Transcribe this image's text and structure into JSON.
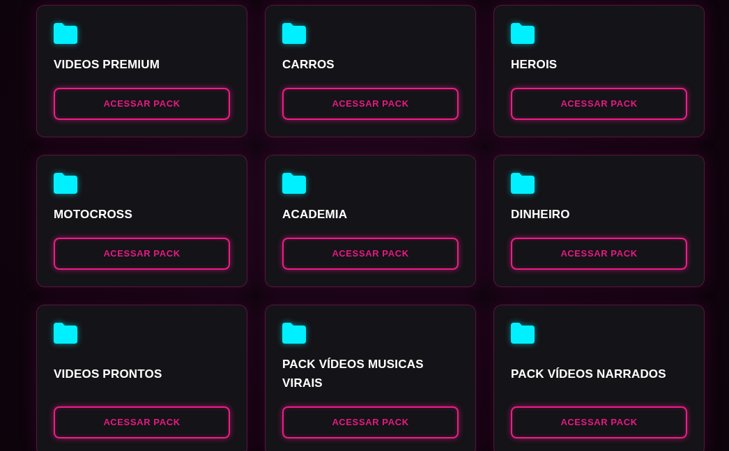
{
  "rows": [
    {
      "packs": [
        {
          "title": "VIDEOS PREMIUM",
          "button": "ACESSAR PACK"
        },
        {
          "title": "CARROS",
          "button": "ACESSAR PACK"
        },
        {
          "title": "HEROIS",
          "button": "ACESSAR PACK"
        }
      ]
    },
    {
      "packs": [
        {
          "title": "MOTOCROSS",
          "button": "ACESSAR PACK"
        },
        {
          "title": "ACADEMIA",
          "button": "ACESSAR PACK"
        },
        {
          "title": "DINHEIRO",
          "button": "ACESSAR PACK"
        }
      ]
    },
    {
      "packs": [
        {
          "title": "VIDEOS PRONTOS",
          "button": "ACESSAR PACK"
        },
        {
          "title": "PACK VÍDEOS MUSICAS VIRAIS",
          "button": "ACESSAR PACK"
        },
        {
          "title": "PACK VÍDEOS NARRADOS",
          "button": "ACESSAR PACK"
        }
      ]
    }
  ]
}
